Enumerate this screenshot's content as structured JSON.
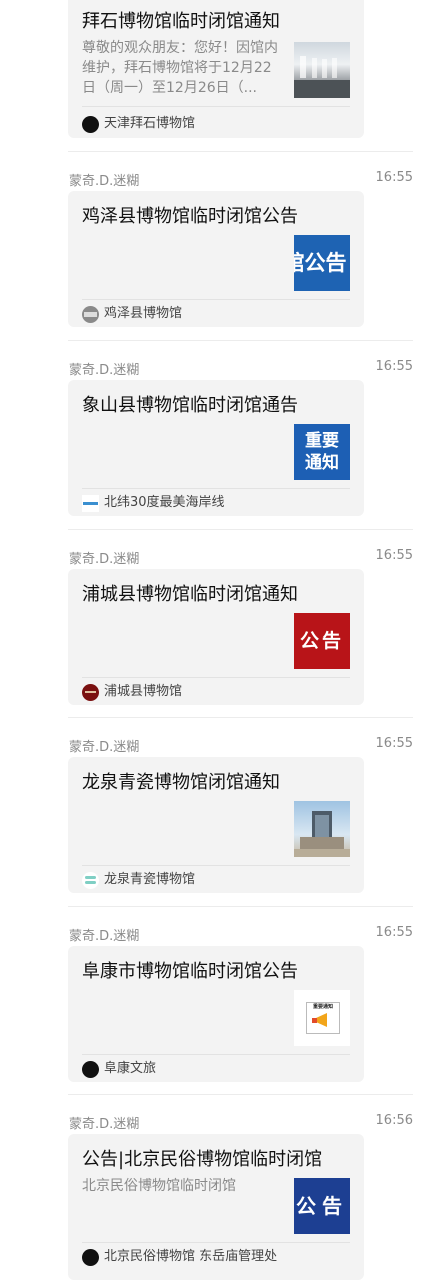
{
  "messages": [
    {
      "sender": "",
      "time": "",
      "title": "拜石博物馆临时闭馆通知",
      "description": "尊敬的观众朋友：您好！因馆内维护，拜石博物馆将于12月22日（周一）至12月26日（...",
      "source": "天津拜石博物馆",
      "thumb_text": ""
    },
    {
      "sender": "蒙奇.D.迷糊",
      "time": "16:55",
      "title": "鸡泽县博物馆临时闭馆公告",
      "description": "",
      "source": "鸡泽县博物馆",
      "thumb_text": "馆公告"
    },
    {
      "sender": "蒙奇.D.迷糊",
      "time": "16:55",
      "title": "象山县博物馆临时闭馆通告",
      "description": "",
      "source": "北纬30度最美海岸线",
      "thumb_text": "重要通知"
    },
    {
      "sender": "蒙奇.D.迷糊",
      "time": "16:55",
      "title": "浦城县博物馆临时闭馆通知",
      "description": "",
      "source": "浦城县博物馆",
      "thumb_text": "公告"
    },
    {
      "sender": "蒙奇.D.迷糊",
      "time": "16:55",
      "title": "龙泉青瓷博物馆闭馆通知",
      "description": "",
      "source": "龙泉青瓷博物馆",
      "thumb_text": ""
    },
    {
      "sender": "蒙奇.D.迷糊",
      "time": "16:55",
      "title": "阜康市博物馆临时闭馆公告",
      "description": "",
      "source": "阜康文旅",
      "thumb_text": "重要通知"
    },
    {
      "sender": "蒙奇.D.迷糊",
      "time": "16:56",
      "title": "公告|北京民俗博物馆临时闭馆",
      "description": "北京民俗博物馆临时闭馆",
      "source": "北京民俗博物馆 东岳庙管理处",
      "thumb_text": "公告"
    }
  ],
  "colors": {
    "card_bg": "#f3f3f3",
    "meta_text": "#8a8a8a",
    "blue_thumb": "#1e63b3",
    "red_thumb": "#b81418"
  }
}
